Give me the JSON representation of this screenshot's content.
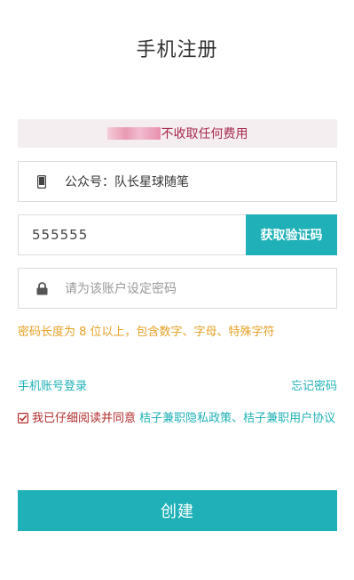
{
  "page": {
    "title": "手机注册"
  },
  "notice": {
    "text": "不收取任何费用"
  },
  "wechat_field": {
    "value": "公众号：队长星球随笔",
    "icon": "phone-icon"
  },
  "code_field": {
    "value": "555555"
  },
  "code_button": {
    "label": "获取验证码"
  },
  "password_field": {
    "placeholder": "请为该账户设定密码",
    "icon": "lock-icon"
  },
  "password_hint": "密码长度为 8 位以上，包含数字、字母、特殊字符",
  "links": {
    "phone_login": "手机账号登录",
    "forgot_password": "忘记密码"
  },
  "agreement": {
    "checked": true,
    "prefix": "我已仔细阅读并同意",
    "policy_links": "桔子兼职隐私政策、桔子兼职用户协议"
  },
  "create_button": {
    "label": "创建"
  },
  "colors": {
    "accent": "#1fb1b7",
    "warning": "#e6a024",
    "notice_text": "#a6294d",
    "agree_text": "#b32b2b"
  }
}
